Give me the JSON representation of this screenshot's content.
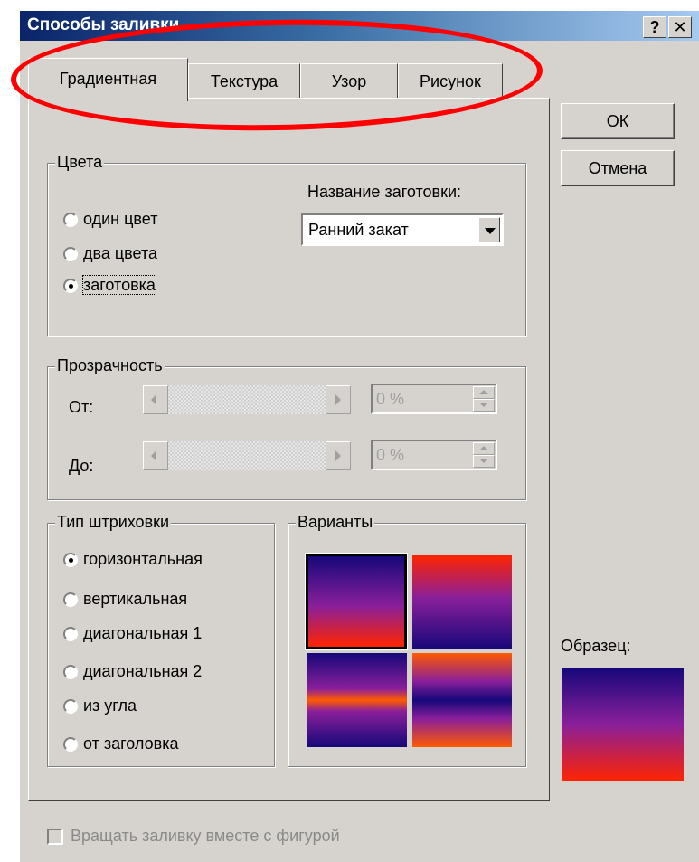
{
  "window": {
    "title": "Способы заливки",
    "help_btn": "?",
    "close_btn": "✕"
  },
  "tabs": [
    {
      "label": "Градиентная",
      "active": true
    },
    {
      "label": "Текстура",
      "active": false
    },
    {
      "label": "Узор",
      "active": false
    },
    {
      "label": "Рисунок",
      "active": false
    }
  ],
  "buttons": {
    "ok": "ОК",
    "cancel": "Отмена"
  },
  "colors": {
    "legend": "Цвета",
    "preset_label": "Название заготовки:",
    "preset_value": "Ранний закат",
    "options": [
      {
        "label": "один цвет",
        "checked": false
      },
      {
        "label": "два цвета",
        "checked": false
      },
      {
        "label": "заготовка",
        "checked": true
      }
    ]
  },
  "transparency": {
    "legend": "Прозрачность",
    "from_label": "От:",
    "to_label": "До:",
    "from_value": "0 %",
    "to_value": "0 %"
  },
  "shading": {
    "legend": "Тип штриховки",
    "options": [
      {
        "label": "горизонтальная",
        "checked": true
      },
      {
        "label": "вертикальная",
        "checked": false
      },
      {
        "label": "диагональная 1",
        "checked": false
      },
      {
        "label": "диагональная 2",
        "checked": false
      },
      {
        "label": "из угла",
        "checked": false
      },
      {
        "label": "от заголовка",
        "checked": false
      }
    ]
  },
  "variants": {
    "legend": "Варианты"
  },
  "sample": {
    "label": "Образец:"
  },
  "rotate_checkbox": {
    "label": "Вращать заливку вместе с фигурой",
    "checked": false,
    "enabled": false
  },
  "gradient_colors": {
    "top": "#16087a",
    "mid": "#8a1f9a",
    "bottom": "#ff2400",
    "band": "#ff5a00"
  }
}
